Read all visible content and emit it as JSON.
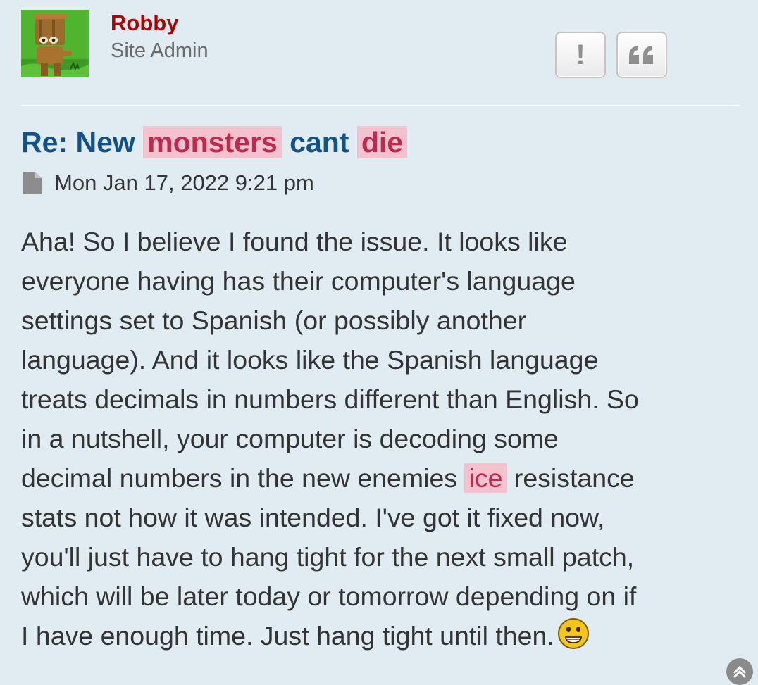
{
  "post": {
    "author": {
      "name": "Robby",
      "rank": "Site Admin"
    },
    "buttons": {
      "report_label": "!",
      "quote_icon": "quote-icon"
    },
    "title": {
      "prefix": "Re: New",
      "highlight1": "monsters",
      "middle": "cant",
      "highlight2": "die"
    },
    "date": "Mon Jan 17, 2022 9:21 pm",
    "body": {
      "line1": "Aha! So I believe I found the issue. It looks like",
      "line2": "everyone having has their computer's language",
      "line3": "settings set to Spanish (or possibly another",
      "line4": "language). And it looks like the Spanish language",
      "line5": "treats decimals in numbers different than English. So",
      "line6": "in a nutshell, your computer is decoding some",
      "line7_before": "decimal numbers in the new enemies",
      "line7_highlight": "ice",
      "line7_after": "resistance",
      "line8": "stats not how it was intended. I've got it fixed now,",
      "line9": "you'll just have to hang tight for the next small patch,",
      "line10": "which will be later today or tomorrow depending on if",
      "line11": "I have enough time. Just hang tight until then."
    }
  },
  "colors": {
    "background": "#e1ebf2",
    "author": "#aa0000",
    "title": "#105289",
    "highlight_bg": "#f4c1cc",
    "highlight_text": "#bc2a4d"
  }
}
